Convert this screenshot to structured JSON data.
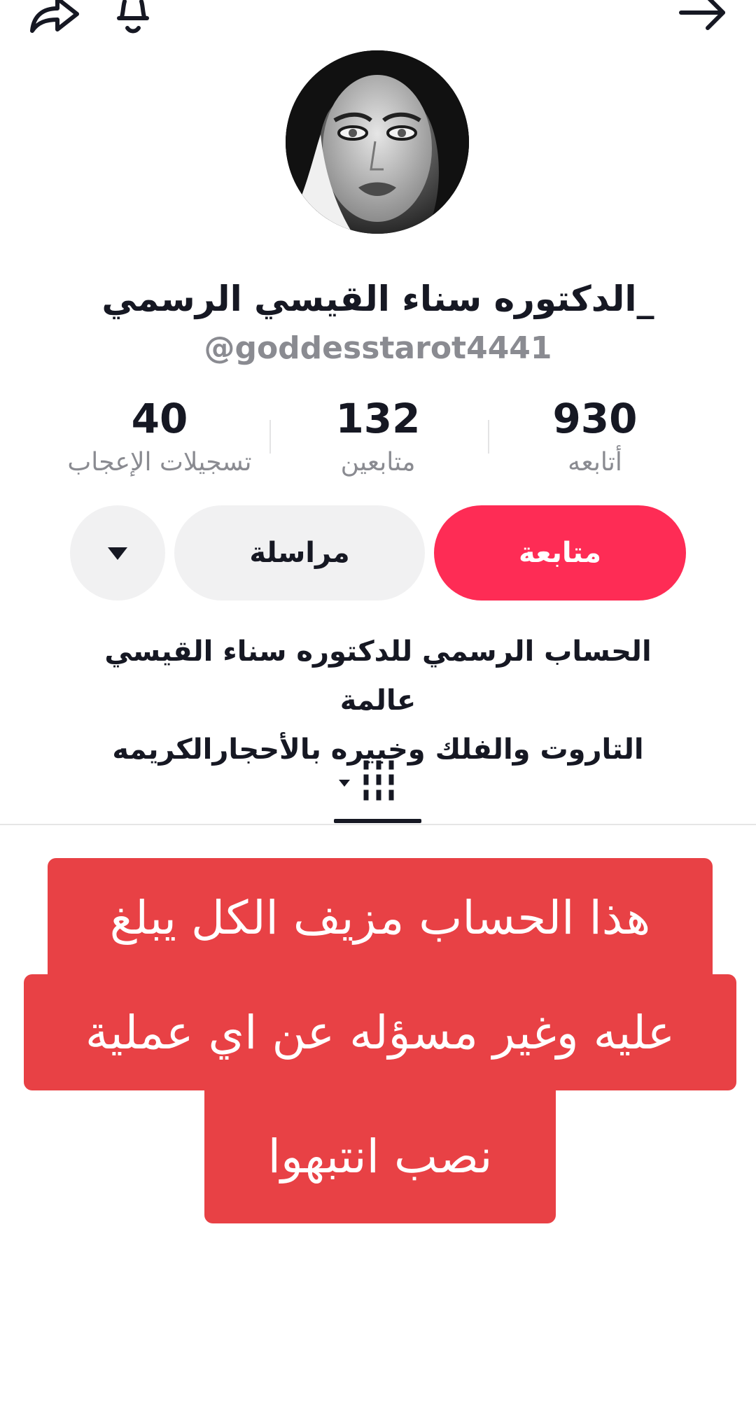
{
  "toolbar": {
    "share_icon": "share-icon",
    "bell_icon": "bell-icon",
    "back_icon": "arrow-right-icon"
  },
  "profile": {
    "display_name": "_الدكتوره سناء القيسي الرسمي",
    "username": "@goddesstarot4441"
  },
  "stats": {
    "following": {
      "count": "930",
      "label": "أتابعه"
    },
    "followers": {
      "count": "132",
      "label": "متابعين"
    },
    "likes": {
      "count": "40",
      "label": "تسجيلات الإعجاب"
    }
  },
  "actions": {
    "follow_label": "متابعة",
    "message_label": "مراسلة",
    "more_icon": "caret-down-icon"
  },
  "bio": {
    "line1": "الحساب الرسمي للدكتوره سناء القيسي عالمة",
    "line2": "التاروت والفلك وخبيره بالأحجارالكريمه"
  },
  "tabs": {
    "active_icon": "video-grid-icon"
  },
  "warning": {
    "line1": "هذا الحساب مزيف الكل يبلغ",
    "line2": "عليه وغير مسؤله عن اي عملية",
    "line3": "نصب انتبهوا"
  },
  "colors": {
    "accent": "#fe2c55",
    "warning_bg": "#e84145",
    "secondary_button": "#f1f1f2",
    "muted_text": "#8a8b91"
  }
}
